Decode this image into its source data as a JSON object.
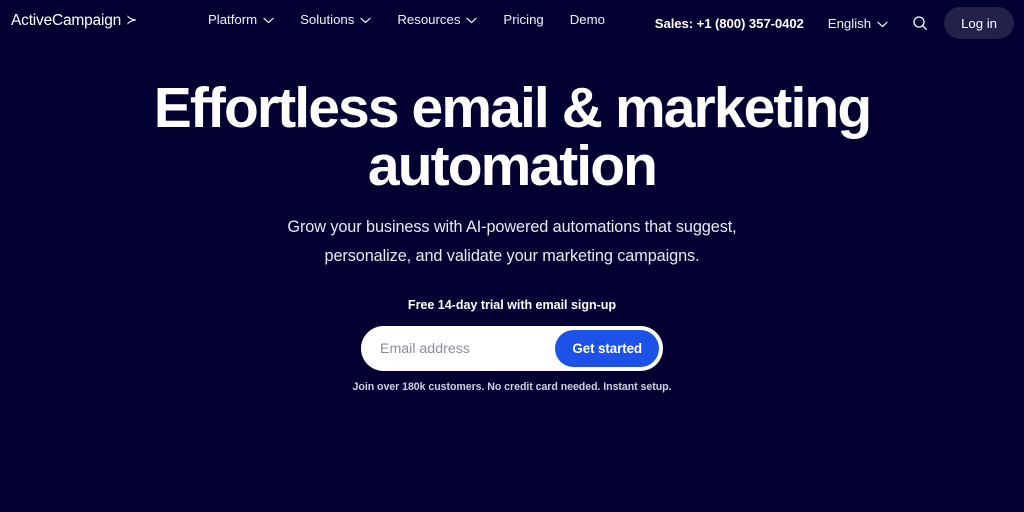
{
  "theme": {
    "background": "#010030",
    "accent_blue": "#1c52e8",
    "text_primary": "#ffffff",
    "text_muted": "#cfcfe0",
    "form_background": "#ffffff"
  },
  "nav": {
    "brand": {
      "name": "ActiveCampaign",
      "arrow_glyph": "≻"
    },
    "menu": [
      {
        "label": "Platform",
        "has_dropdown": true
      },
      {
        "label": "Solutions",
        "has_dropdown": true
      },
      {
        "label": "Resources",
        "has_dropdown": true
      },
      {
        "label": "Pricing",
        "has_dropdown": false
      },
      {
        "label": "Demo",
        "has_dropdown": false
      }
    ],
    "sales_label": "Sales: +1 (800) 357-0402",
    "language_label": "English",
    "search_icon": "search-icon",
    "login_label": "Log in"
  },
  "hero": {
    "headline": "Effortless email & marketing automation",
    "subheadline": "Grow your business with AI-powered automations that suggest, personalize, and validate your marketing campaigns.",
    "trial_note": "Free 14-day trial with email sign-up",
    "form": {
      "email_placeholder": "Email address",
      "email_value": "",
      "submit_label": "Get started"
    },
    "fineprint": "Join over 180k customers. No credit card needed. Instant setup."
  }
}
